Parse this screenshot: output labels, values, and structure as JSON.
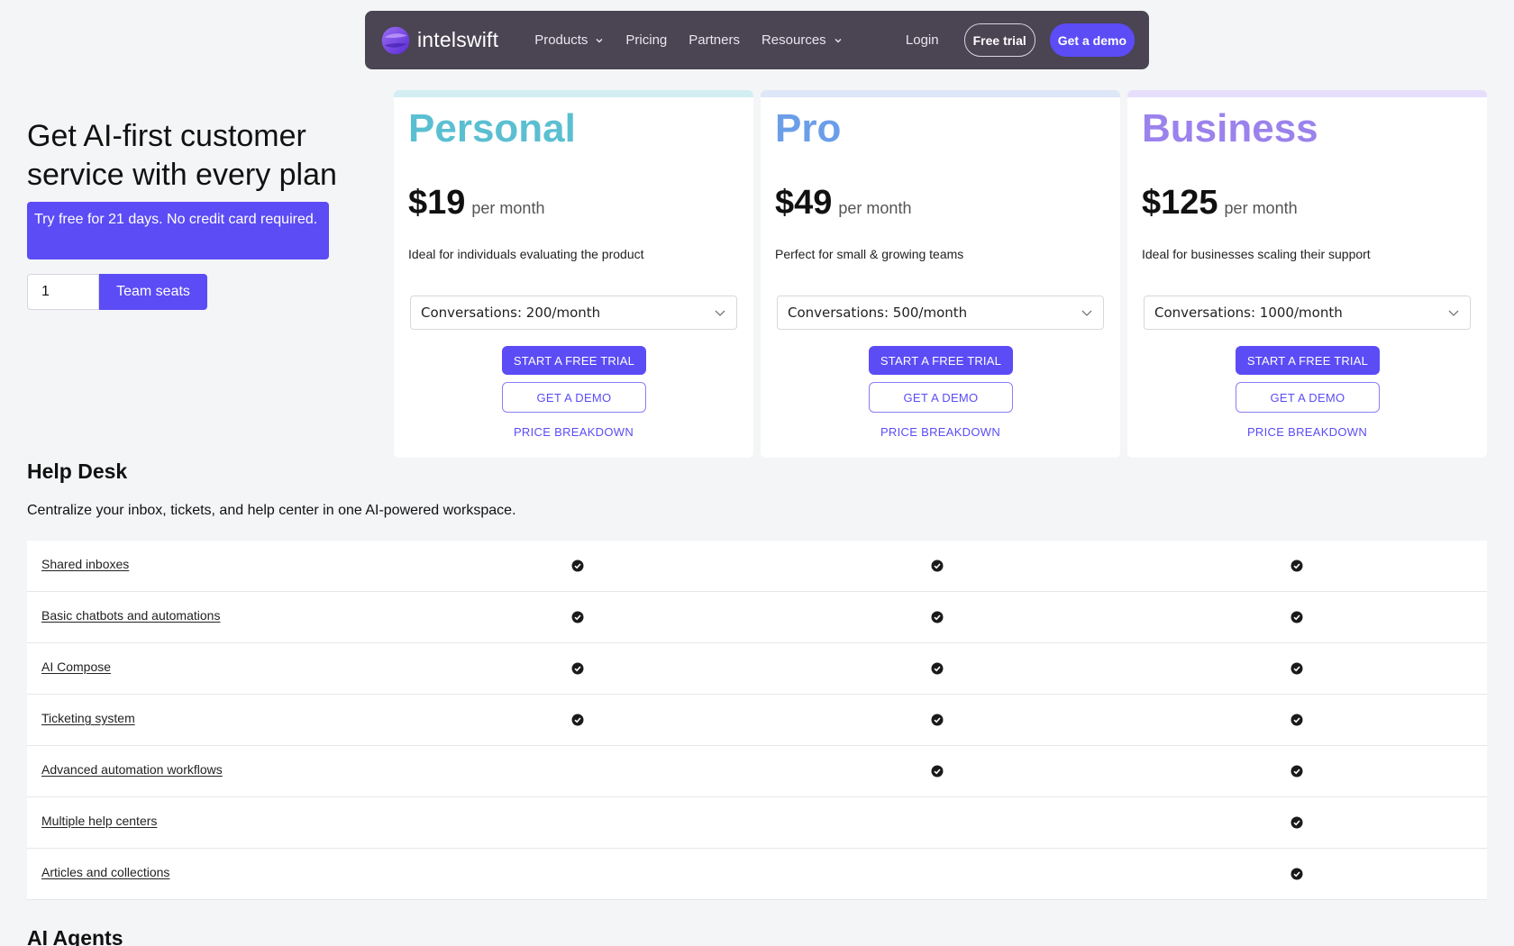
{
  "nav": {
    "logo_text": "intelswift",
    "links": [
      {
        "label": "Products",
        "dropdown": true
      },
      {
        "label": "Pricing",
        "dropdown": false
      },
      {
        "label": "Partners",
        "dropdown": false
      },
      {
        "label": "Resources",
        "dropdown": true
      }
    ],
    "login": "Login",
    "free_trial": "Free trial",
    "get_demo": "Get a demo"
  },
  "hero": {
    "title": "Get AI-first customer service with every plan",
    "trial_note": "Try free for 21 days. No credit card required.",
    "seats_value": "1",
    "seats_label": "Team seats"
  },
  "plans": [
    {
      "name": "Personal",
      "color": "#5bbfd2",
      "top_color": "#d3eef3",
      "price": "$19",
      "unit": "per month",
      "description": "Ideal for individuals evaluating the product",
      "conversations": "Conversations: 200/month",
      "trial_label": "START A FREE TRIAL",
      "demo_label": "GET A DEMO",
      "breakdown_label": "PRICE BREAKDOWN"
    },
    {
      "name": "Pro",
      "color": "#6b9ee8",
      "top_color": "#dde7f8",
      "price": "$49",
      "unit": "per month",
      "description": "Perfect for small & growing teams",
      "conversations": "Conversations: 500/month",
      "trial_label": "START A FREE TRIAL",
      "demo_label": "GET A DEMO",
      "breakdown_label": "PRICE BREAKDOWN"
    },
    {
      "name": "Business",
      "color": "#9b82ec",
      "top_color": "#e6defa",
      "price": "$125",
      "unit": "per month",
      "description": "Ideal for businesses scaling their support",
      "conversations": "Conversations: 1000/month",
      "trial_label": "START A FREE TRIAL",
      "demo_label": "GET A DEMO",
      "breakdown_label": "PRICE BREAKDOWN"
    }
  ],
  "help_desk": {
    "title": "Help Desk",
    "subtitle": "Centralize your inbox, tickets, and help center in one AI-powered workspace.",
    "features": [
      {
        "name": "Shared inboxes",
        "checks": [
          true,
          true,
          true
        ]
      },
      {
        "name": "Basic chatbots and automations",
        "checks": [
          true,
          true,
          true
        ]
      },
      {
        "name": "AI Compose",
        "checks": [
          true,
          true,
          true
        ]
      },
      {
        "name": "Ticketing system",
        "checks": [
          true,
          true,
          true
        ]
      },
      {
        "name": "Advanced automation workflows",
        "checks": [
          false,
          true,
          true
        ]
      },
      {
        "name": "Multiple help centers",
        "checks": [
          false,
          false,
          true
        ]
      },
      {
        "name": "Articles and collections",
        "checks": [
          false,
          false,
          true
        ]
      }
    ]
  },
  "ai_agents": {
    "title": "AI Agents"
  },
  "icons": {
    "logo": "intelswift-logo-icon",
    "chevron": "chevron-down-icon",
    "check": "check-circle-icon"
  }
}
